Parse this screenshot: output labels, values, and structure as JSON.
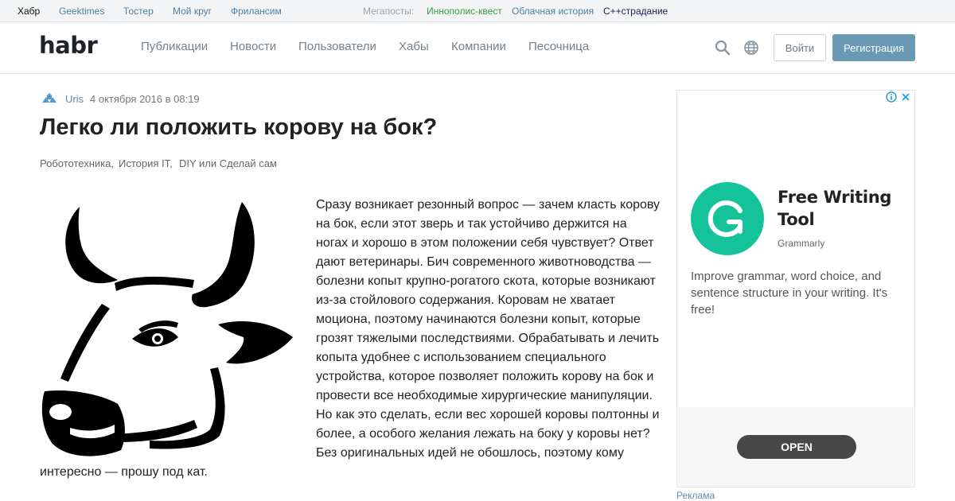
{
  "topbar": {
    "home": "Хабр",
    "links": [
      "Geektimes",
      "Тостер",
      "Мой круг",
      "Фрилансим"
    ],
    "mega_label": "Мегапосты:",
    "mega_links": [
      "Иннополис-квест",
      "Облачная история",
      "C++страдание"
    ]
  },
  "header": {
    "logo": "habr",
    "nav": [
      "Публикации",
      "Новости",
      "Пользователи",
      "Хабы",
      "Компании",
      "Песочница"
    ],
    "login_label": "Войти",
    "register_label": "Регистрация",
    "icons": [
      "search-icon",
      "globe-icon"
    ]
  },
  "article": {
    "author": "Uris",
    "date": "4 октября 2016 в 08:19",
    "title": "Легко ли положить корову на бок?",
    "hubs": [
      "Робототехника,",
      "История IT,",
      "DIY или Сделай сам"
    ],
    "image": "cow-head-illustration",
    "lines": [
      "Сразу возникает резонный вопрос — зачем класть корову",
      "на бок, если этот зверь и так устойчиво держится на",
      "ногах и хорошо в этом положении себя чувствует? Ответ",
      "дают ветеринары. Бич современного животноводства —",
      "болезни копыт крупно-рогатого скота, которые возникают",
      "из-за стойлового содержания. Коровам не хватает",
      "моциона, поэтому начинаются болезни копыт, которые",
      "грозят тяжелыми последствиями. Обрабатывать и лечить",
      "копыта удобнее с использованием специального",
      "устройства, которое позволяет положить корову на бок и",
      "провести все необходимые хирургические манипуляции.",
      "Но как это сделать, если вес хорошей коровы полтонны и",
      "более, а особого желания лежать на боку у коровы нет?",
      "Без оригинальных идей не обошлось, поэтому кому",
      "интересно — прошу под кат."
    ]
  },
  "ad": {
    "title": "Free Writing Tool",
    "brand": "Grammarly",
    "description": "Improve grammar, word choice, and sentence structure in your writing. It's free!",
    "cta": "OPEN",
    "label": "Реклама",
    "brand_color": "#15c39a"
  }
}
